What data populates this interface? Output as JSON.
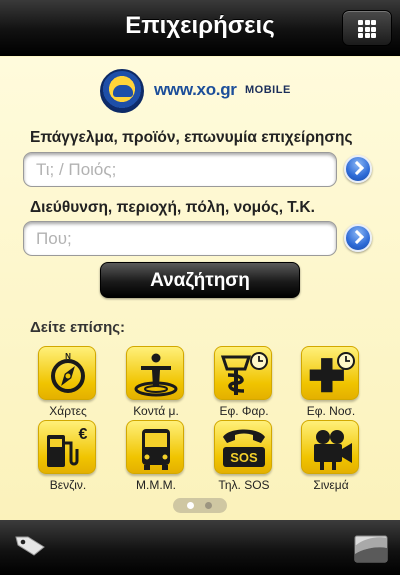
{
  "header": {
    "title": "Επιχειρήσεις"
  },
  "logo": {
    "text": "www.xo.gr",
    "suffix": "MOBILE"
  },
  "search": {
    "what_label": "Επάγγελμα, προϊόν, επωνυμία επιχείρησης",
    "what_placeholder": "Τι; / Ποιός;",
    "where_label": "Διεύθυνση, περιοχή, πόλη, νομός, Τ.Κ.",
    "where_placeholder": "Που;",
    "submit_label": "Αναζήτηση"
  },
  "see_also": {
    "title": "Δείτε επίσης:",
    "items": [
      {
        "label": "Χάρτες",
        "icon": "compass-icon"
      },
      {
        "label": "Κοντά μ.",
        "icon": "person-nearby-icon"
      },
      {
        "label": "Εφ. Φαρ.",
        "icon": "pharmacy-clock-icon"
      },
      {
        "label": "Εφ. Νοσ.",
        "icon": "hospital-cross-clock-icon"
      },
      {
        "label": "Βενζιν.",
        "icon": "fuel-pump-euro-icon"
      },
      {
        "label": "Μ.Μ.Μ.",
        "icon": "bus-icon"
      },
      {
        "label": "Τηλ. SOS",
        "icon": "sos-phone-icon",
        "text": "SOS"
      },
      {
        "label": "Σινεμά",
        "icon": "movie-camera-icon"
      }
    ]
  },
  "pager": {
    "pages": 2,
    "current": 1
  },
  "colors": {
    "tile_yellow": "#f5cf1c",
    "bar_dark": "#111111",
    "go_blue": "#2d6ad6",
    "background": "#fdf6c5"
  }
}
